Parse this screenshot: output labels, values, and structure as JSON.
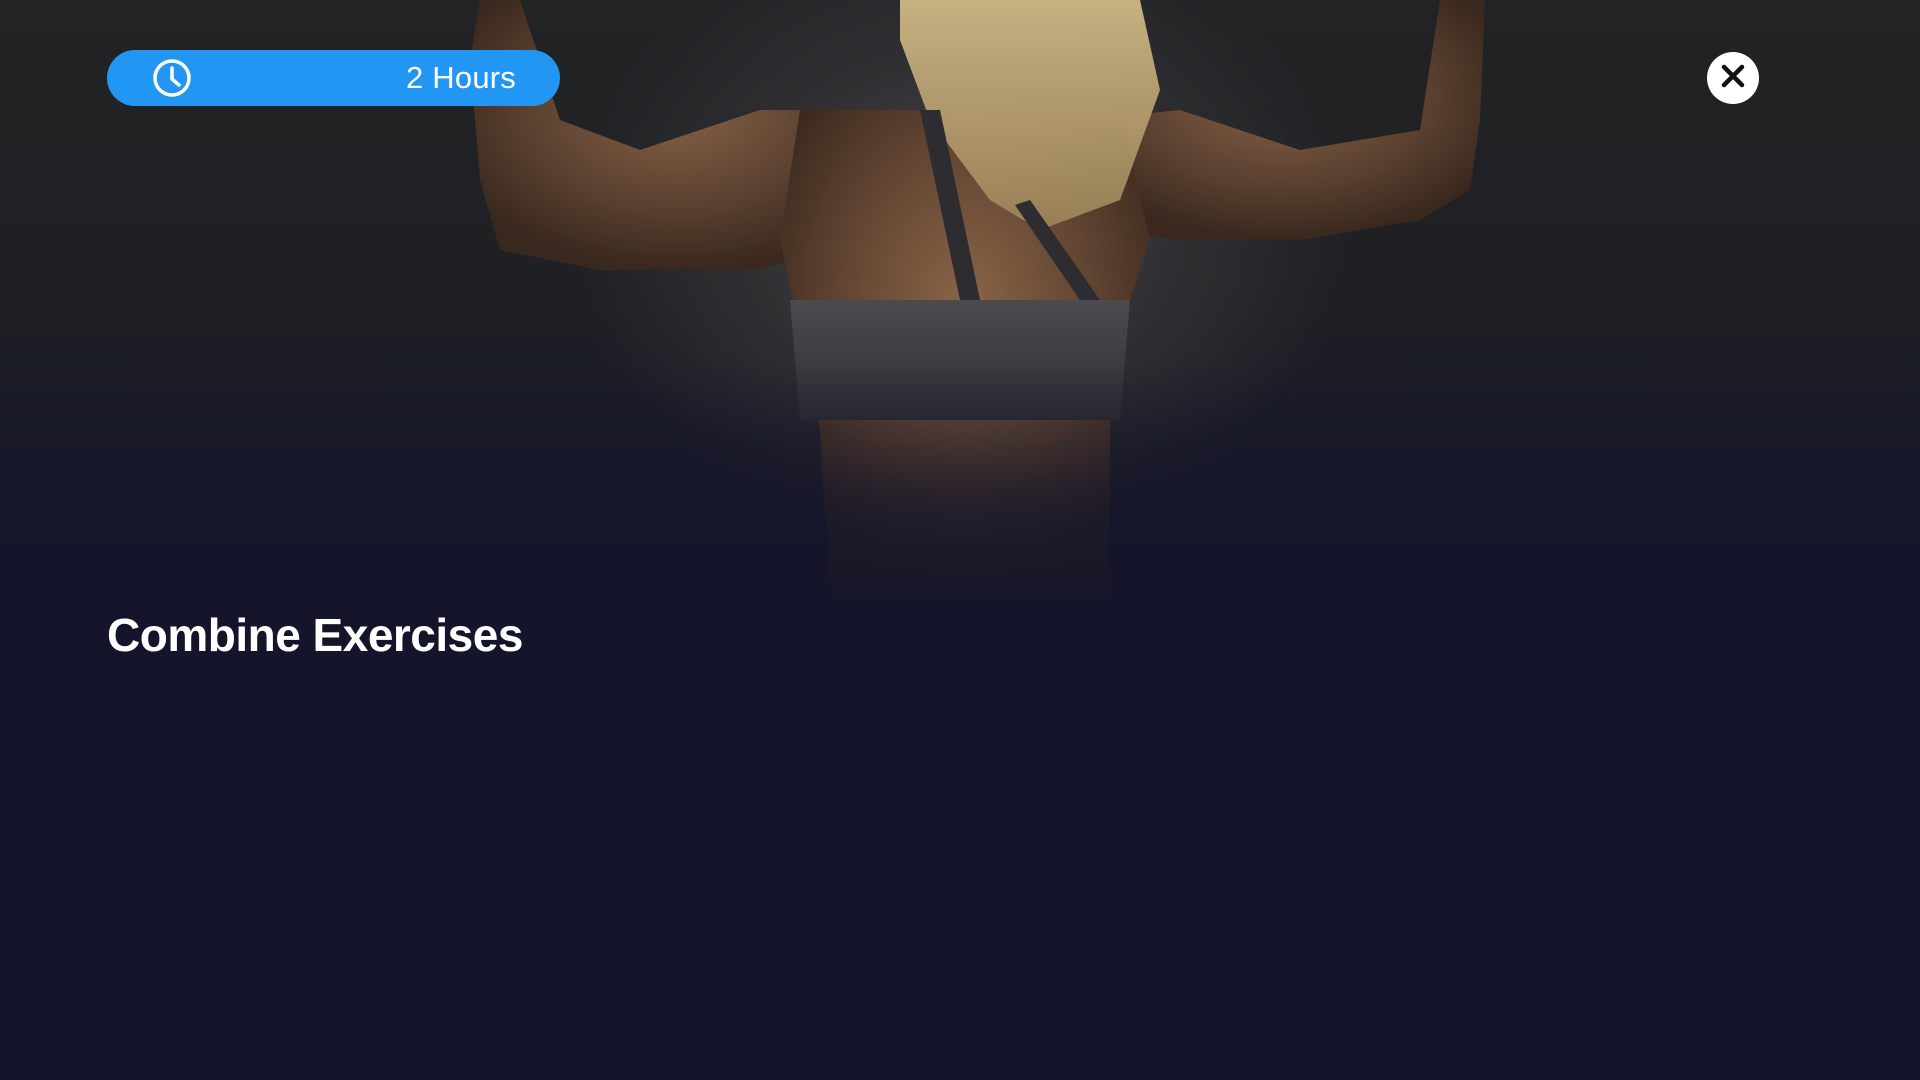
{
  "workout": {
    "duration_label": "2 Hours",
    "title": "Combine Exercises"
  },
  "icons": {
    "duration": "clock-icon",
    "close": "close-icon"
  },
  "colors": {
    "accent": "#2196f3",
    "background": "#14152a",
    "text": "#ffffff"
  }
}
